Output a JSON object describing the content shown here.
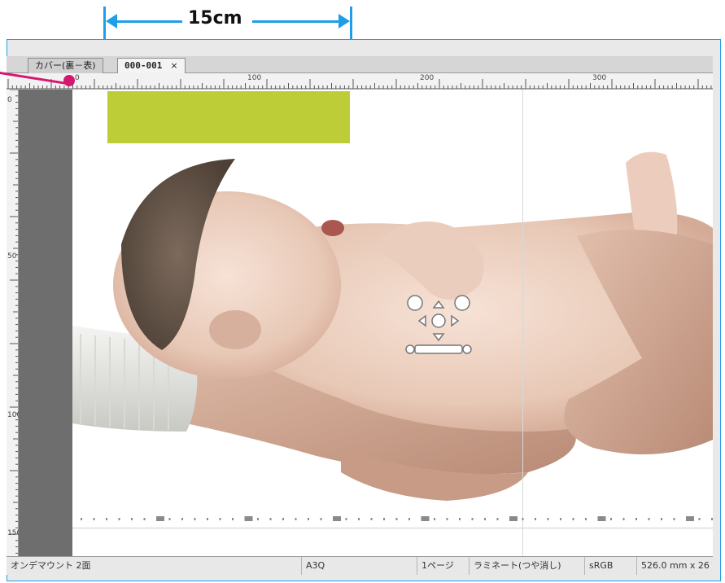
{
  "annotation": {
    "dimension_label": "15cm",
    "accent_color": "#1f9ee8",
    "pointer_color": "#d6176e",
    "green_box_color": "#bccd37"
  },
  "tabs": [
    {
      "label": "カバー(裏－表)",
      "active": false
    },
    {
      "label": "000-001",
      "active": true,
      "close": "×"
    }
  ],
  "ruler": {
    "horizontal_labels": [
      "0",
      "100",
      "200",
      "300"
    ],
    "vertical_labels": [
      "0",
      "50",
      "100",
      "150"
    ]
  },
  "status_bar": {
    "product": "オンデマウント 2面",
    "paper": "A3Q",
    "pages": "1ページ",
    "finish": "ラミネート(つや消し)",
    "color_space": "sRGB",
    "size": "526.0 mm x 26"
  },
  "icons": {
    "tab_close": "close-icon",
    "rotate_left": "rotate-left-icon",
    "rotate_right": "rotate-right-icon",
    "move": "move-arrows-icon",
    "zoom_out": "zoom-out-icon",
    "zoom_in": "zoom-in-icon"
  }
}
